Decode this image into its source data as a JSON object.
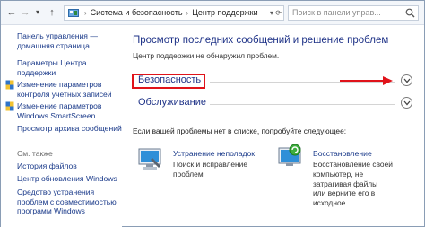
{
  "address_bar": {
    "nav": {
      "back": "←",
      "forward": "→",
      "recent": "▾",
      "up": "↑"
    },
    "breadcrumb": [
      "Система и безопасность",
      "Центр поддержки"
    ],
    "search_placeholder": "Поиск в панели управ..."
  },
  "left_pane": {
    "links": [
      {
        "label": "Панель управления —",
        "label2": "домашняя страница"
      },
      {
        "label": "Параметры Центра",
        "label2": "поддержки"
      },
      {
        "label": "Изменение параметров",
        "label2": "контроля учетных записей",
        "icon": "shield-icon"
      },
      {
        "label": "Изменение параметров",
        "label2": "Windows SmartScreen",
        "icon": "shield-icon"
      },
      {
        "label": "Просмотр архива сообщений"
      }
    ],
    "see_also_heading": "См. также",
    "see_also": [
      {
        "label": "История файлов"
      },
      {
        "label": "Центр обновления Windows"
      },
      {
        "label": "Средство устранения",
        "label2": "проблем с совместимостью",
        "label3": "программ Windows"
      }
    ]
  },
  "main": {
    "title": "Просмотр последних сообщений и решение проблем",
    "subtitle": "Центр поддержки не обнаружил проблем.",
    "sections": [
      {
        "label": "Безопасность",
        "expanded": false
      },
      {
        "label": "Обслуживание",
        "expanded": false
      }
    ],
    "problem_text": "Если вашей проблемы нет в списке, попробуйте следующее:",
    "tools": [
      {
        "title": "Устранение неполадок",
        "desc": [
          "Поиск и исправление",
          "проблем"
        ]
      },
      {
        "title": "Восстановление",
        "desc": [
          "Восстановление своей",
          "компьютер, не",
          "затрагивая файлы",
          "или верните его в",
          "исходное..."
        ]
      }
    ]
  },
  "colors": {
    "link": "#1a3a8a",
    "heading": "#1e3287",
    "highlight": "#e0131a"
  }
}
